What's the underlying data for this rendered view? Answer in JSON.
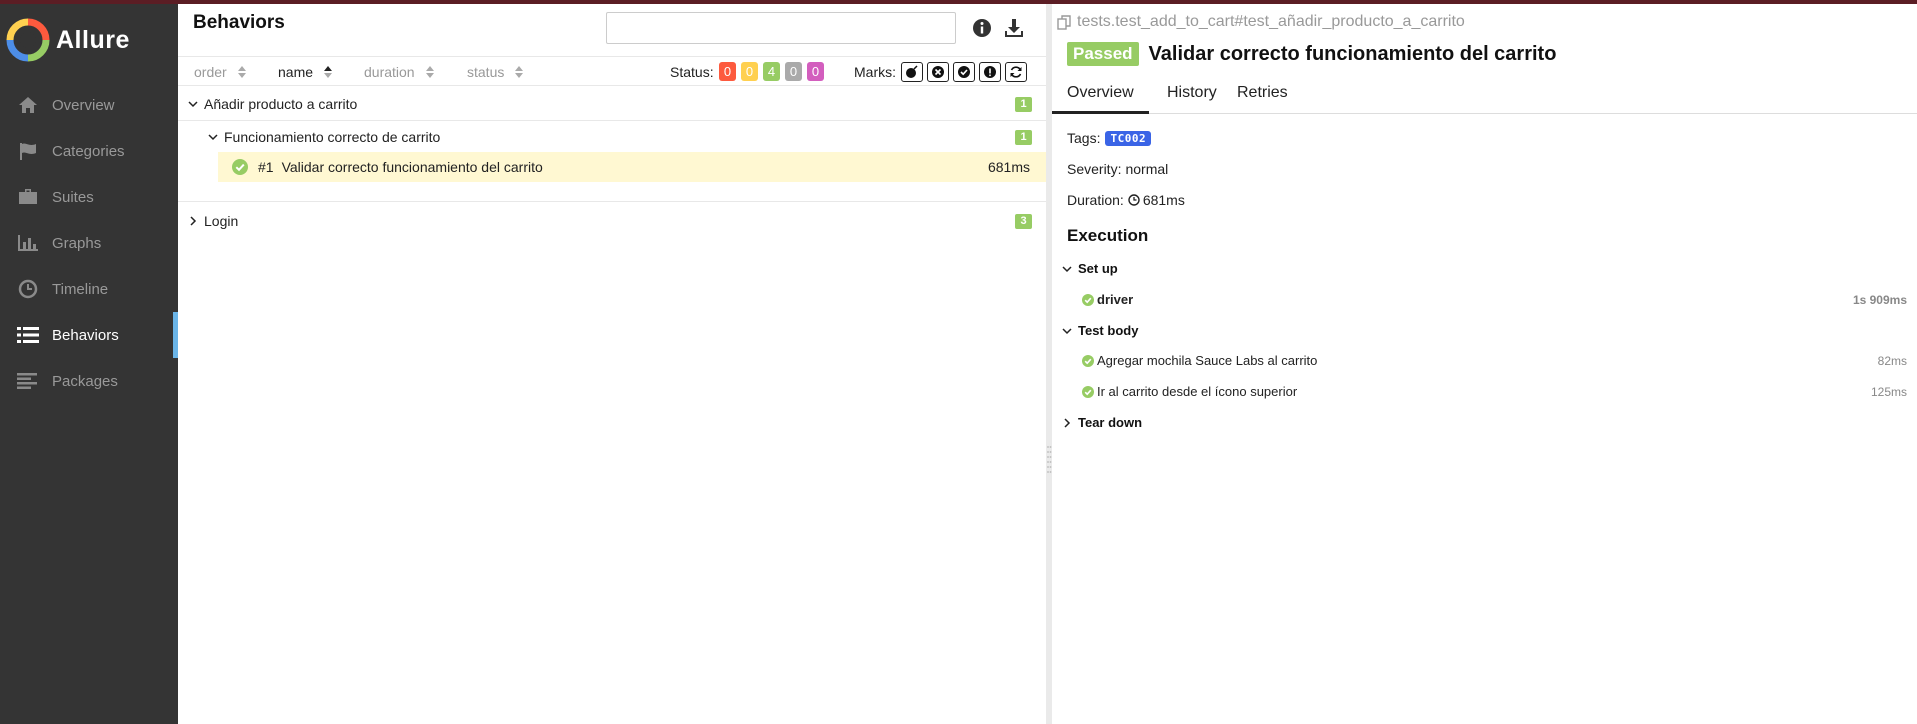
{
  "app": {
    "name": "Allure"
  },
  "colors": {
    "sidebar_bg": "#343434",
    "active_accent": "#6bb5e8",
    "passed": "#97cc64",
    "failed": "#fd5a3e",
    "broken": "#ffd050",
    "skipped": "#aaaaaa",
    "unknown": "#d35ebe",
    "tag": "#3a64e6",
    "selected_row": "#fff8d2"
  },
  "sidebar": {
    "items": [
      {
        "label": "Overview",
        "icon": "home-icon"
      },
      {
        "label": "Categories",
        "icon": "flag-icon"
      },
      {
        "label": "Suites",
        "icon": "briefcase-icon"
      },
      {
        "label": "Graphs",
        "icon": "bar-chart-icon"
      },
      {
        "label": "Timeline",
        "icon": "clock-icon"
      },
      {
        "label": "Behaviors",
        "icon": "list-icon",
        "active": true
      },
      {
        "label": "Packages",
        "icon": "align-left-icon"
      }
    ]
  },
  "tree": {
    "title": "Behaviors",
    "search": {
      "value": "",
      "placeholder": ""
    },
    "sort": {
      "order": "order",
      "name": "name",
      "duration": "duration",
      "status": "status"
    },
    "status_label": "Status:",
    "status_counts": [
      "0",
      "0",
      "4",
      "0",
      "0"
    ],
    "marks_label": "Marks:",
    "rows": {
      "epic": {
        "label": "Añadir producto a carrito",
        "count": "1"
      },
      "feature": {
        "label": "Funcionamiento correcto de carrito",
        "count": "1"
      },
      "test": {
        "number": "#1",
        "label": "Validar correcto funcionamiento del carrito",
        "duration": "681ms"
      },
      "login": {
        "label": "Login",
        "count": "3"
      }
    }
  },
  "detail": {
    "path": "tests.test_add_to_cart#test_añadir_producto_a_carrito",
    "status": "Passed",
    "title": "Validar correcto funcionamiento del carrito",
    "tabs": [
      "Overview",
      "History",
      "Retries"
    ],
    "tags_label": "Tags:",
    "tag": "TC002",
    "severity_label": "Severity:",
    "severity": "normal",
    "duration_label": "Duration:",
    "duration": "681ms",
    "execution_heading": "Execution",
    "setup": {
      "label": "Set up",
      "steps": [
        {
          "label": "driver",
          "duration": "1s 909ms"
        }
      ]
    },
    "body": {
      "label": "Test body",
      "steps": [
        {
          "label": "Agregar mochila Sauce Labs al carrito",
          "duration": "82ms"
        },
        {
          "label": "Ir al carrito desde el ícono superior",
          "duration": "125ms"
        }
      ]
    },
    "teardown": {
      "label": "Tear down"
    }
  }
}
